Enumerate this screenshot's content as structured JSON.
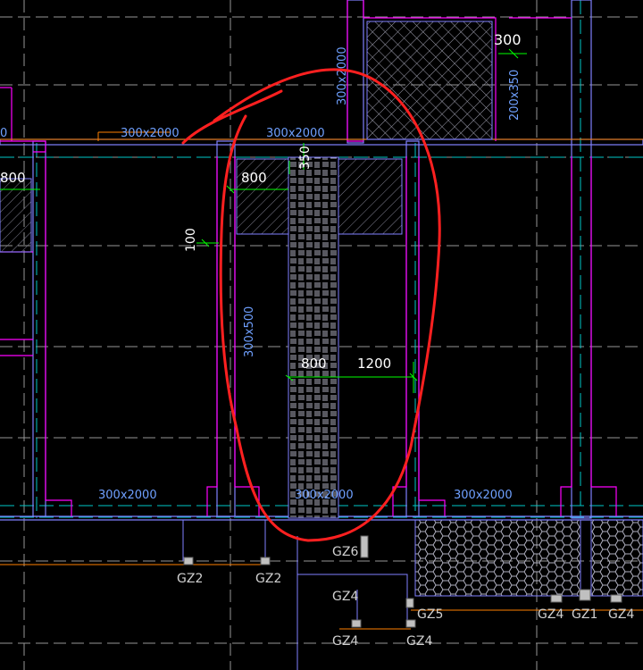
{
  "colors": {
    "background": "#000000",
    "grid_dashed": "#c8c8c8",
    "wall": "#8080ff",
    "cyan_line": "#00c8c8",
    "magenta_line": "#ff00ff",
    "green_dim": "#00ff00",
    "text_white": "#ffffff",
    "text_cyan": "#6fa0ff",
    "orange_line": "#ff8000",
    "red_markup": "#ff2020",
    "hatch": "#9090a0"
  },
  "labels": {
    "beam_left_top": "300x2000",
    "beam_mid_top": "300x2000",
    "beam_vertical_top": "300x2000",
    "beam_right_vertical": "200x350",
    "beam_vertical_mid": "300x500",
    "beam_bottom_left": "300x2000",
    "beam_bottom_mid": "300x2000",
    "beam_bottom_right": "300x2000",
    "dim_800_top": "800",
    "dim_800_left": "800",
    "dim_350": "350",
    "dim_100": "100",
    "dim_800_mid": "800",
    "dim_1200": "1200",
    "dim_300": "300",
    "left_edge_text": "0"
  },
  "column_tags": {
    "gz2_a": "GZ2",
    "gz2_b": "GZ2",
    "gz6": "GZ6",
    "gz4_a": "GZ4",
    "gz4_b": "GZ4",
    "gz5": "GZ5",
    "gz4_c": "GZ4",
    "gz4_d": "GZ4",
    "gz1": "GZ1",
    "gz4_e": "GZ4"
  }
}
